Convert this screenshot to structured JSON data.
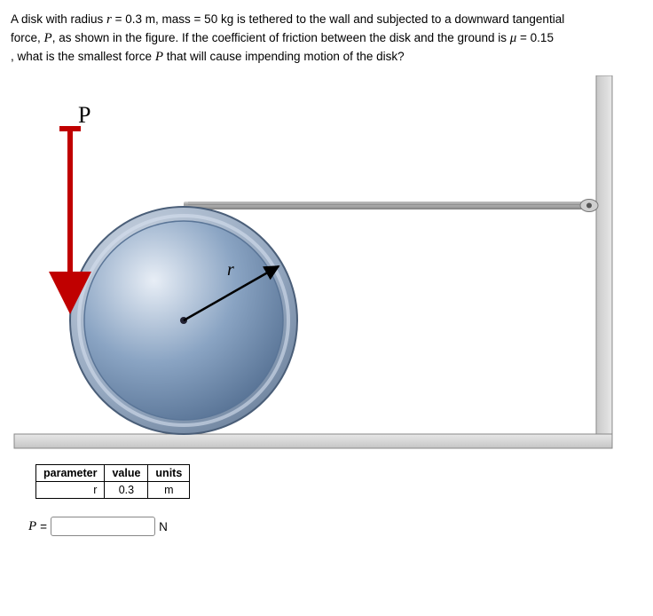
{
  "problem": {
    "line1a": "A disk with radius ",
    "r_var": "r",
    "eq1": " = ",
    "r_val_txt": " 0.3 m, mass = 50 kg is tethered to the wall and subjected to a downward tangential",
    "line2a": "force, ",
    "P_var": "P",
    "line2b": ", as shown in the figure. If the coefficient of friction between the disk and the ground is ",
    "mu": "μ",
    "eq2": " = ",
    "mu_val": "0.15",
    "line3a": ", what is the smallest force ",
    "P_var2": "P",
    "line3b": " that will cause impending motion of the disk?"
  },
  "figure": {
    "label_P": "P",
    "label_r": "r"
  },
  "table": {
    "h_param": "parameter",
    "h_value": "value",
    "h_units": "units",
    "rows": [
      {
        "p": "r",
        "v": "0.3",
        "u": "m"
      }
    ]
  },
  "answer": {
    "label": "P",
    "equals": " = ",
    "value": "",
    "units": "N"
  }
}
